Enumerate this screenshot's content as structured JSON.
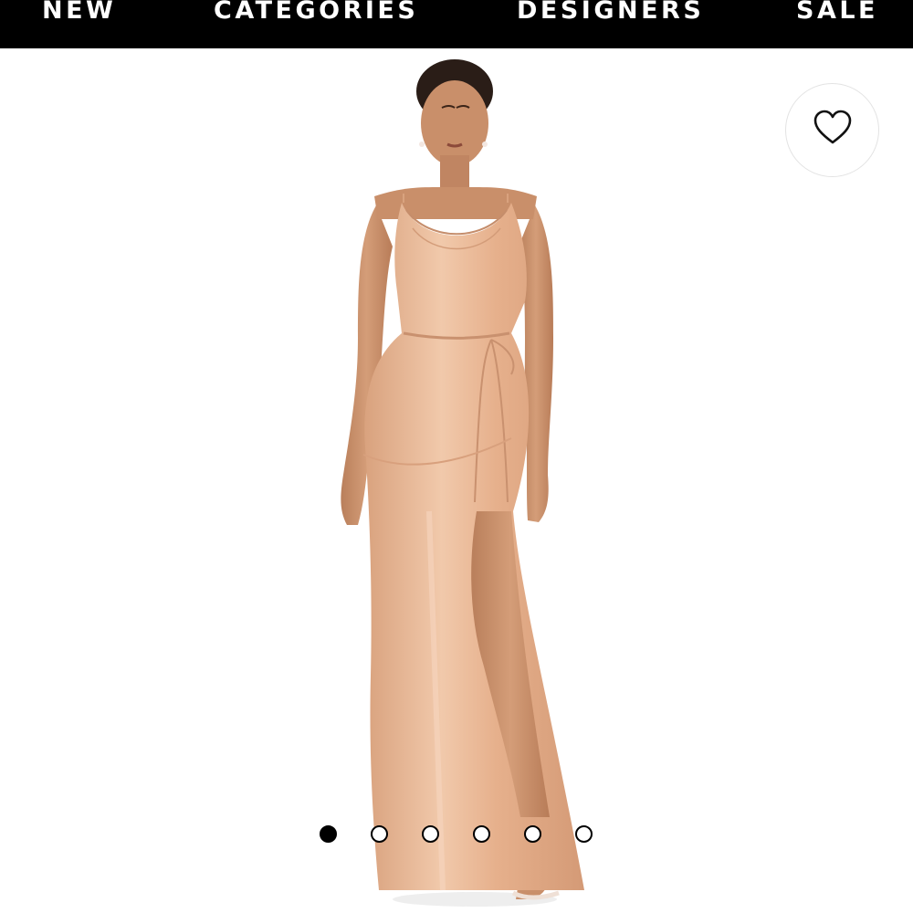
{
  "nav": {
    "items": [
      {
        "label": "NEW"
      },
      {
        "label": "CATEGORIES"
      },
      {
        "label": "DESIGNERS"
      },
      {
        "label": "SALE"
      }
    ]
  },
  "product": {
    "image_subject": "model-in-champagne-satin-cowl-neck-maxi-dress",
    "colors": {
      "dress": "#e8b694",
      "skin": "#c98f6a",
      "hair": "#2a1d17",
      "nav_bg": "#000000"
    }
  },
  "wishlist": {
    "icon": "heart-outline-icon"
  },
  "carousel": {
    "total": 6,
    "active_index": 0
  }
}
